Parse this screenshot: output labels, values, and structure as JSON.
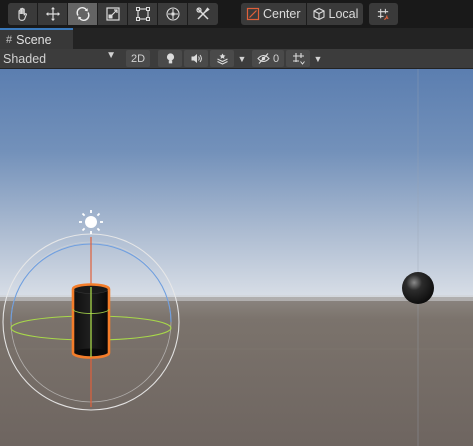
{
  "toolbar": {
    "tools": [
      {
        "name": "hand-tool",
        "icon": "hand-icon"
      },
      {
        "name": "move-tool",
        "icon": "move-arrows-icon"
      },
      {
        "name": "rotate-tool",
        "icon": "rotate-icon",
        "active": true
      },
      {
        "name": "scale-tool",
        "icon": "scale-icon"
      },
      {
        "name": "rect-tool",
        "icon": "rect-transform-icon"
      },
      {
        "name": "transform-tool",
        "icon": "transform-icon"
      },
      {
        "name": "custom-tool",
        "icon": "custom-tools-icon"
      }
    ],
    "pivot_mode_label": "Center",
    "pivot_rotation_label": "Local"
  },
  "tabs": {
    "scene_label": "Scene"
  },
  "scene_toolbar": {
    "shading_mode": "Shaded",
    "mode_2d_label": "2D",
    "hidden_count": "0"
  },
  "colors": {
    "accent": "#3a79bb",
    "selection_outline": "#f47d2a",
    "sky_top": "#5b7eb0",
    "horizon": "#d7dde6",
    "ground": "#766d66"
  }
}
